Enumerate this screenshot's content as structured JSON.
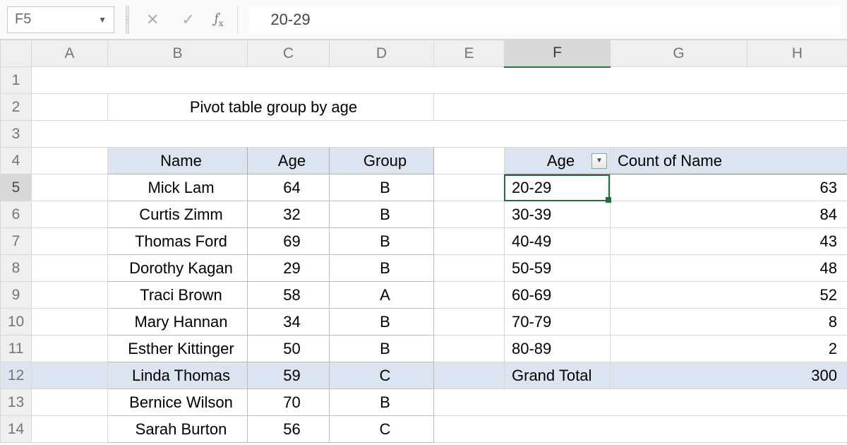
{
  "formula_bar": {
    "cell_ref": "F5",
    "formula_value": "20-29"
  },
  "columns": [
    "A",
    "B",
    "C",
    "D",
    "E",
    "F",
    "G",
    "H"
  ],
  "selected_col": "F",
  "rows": [
    1,
    2,
    3,
    4,
    5,
    6,
    7,
    8,
    9,
    10,
    11,
    12,
    13,
    14
  ],
  "selected_row": 5,
  "title": "Pivot table group by age",
  "source_table": {
    "headers": {
      "name": "Name",
      "age": "Age",
      "group": "Group"
    },
    "rows": [
      {
        "name": "Mick Lam",
        "age": 64,
        "group": "B"
      },
      {
        "name": "Curtis Zimm",
        "age": 32,
        "group": "B"
      },
      {
        "name": "Thomas Ford",
        "age": 69,
        "group": "B"
      },
      {
        "name": "Dorothy Kagan",
        "age": 29,
        "group": "B"
      },
      {
        "name": "Traci Brown",
        "age": 58,
        "group": "A"
      },
      {
        "name": "Mary Hannan",
        "age": 34,
        "group": "B"
      },
      {
        "name": "Esther Kittinger",
        "age": 50,
        "group": "B"
      },
      {
        "name": "Linda Thomas",
        "age": 59,
        "group": "C"
      },
      {
        "name": "Bernice Wilson",
        "age": 70,
        "group": "B"
      },
      {
        "name": "Sarah Burton",
        "age": 56,
        "group": "C"
      }
    ]
  },
  "pivot_table": {
    "headers": {
      "range": "Age",
      "count": "Count of Name"
    },
    "rows": [
      {
        "range": "20-29",
        "count": 63
      },
      {
        "range": "30-39",
        "count": 84
      },
      {
        "range": "40-49",
        "count": 43
      },
      {
        "range": "50-59",
        "count": 48
      },
      {
        "range": "60-69",
        "count": 52
      },
      {
        "range": "70-79",
        "count": 8
      },
      {
        "range": "80-89",
        "count": 2
      }
    ],
    "total_label": "Grand Total",
    "total_value": 300
  }
}
